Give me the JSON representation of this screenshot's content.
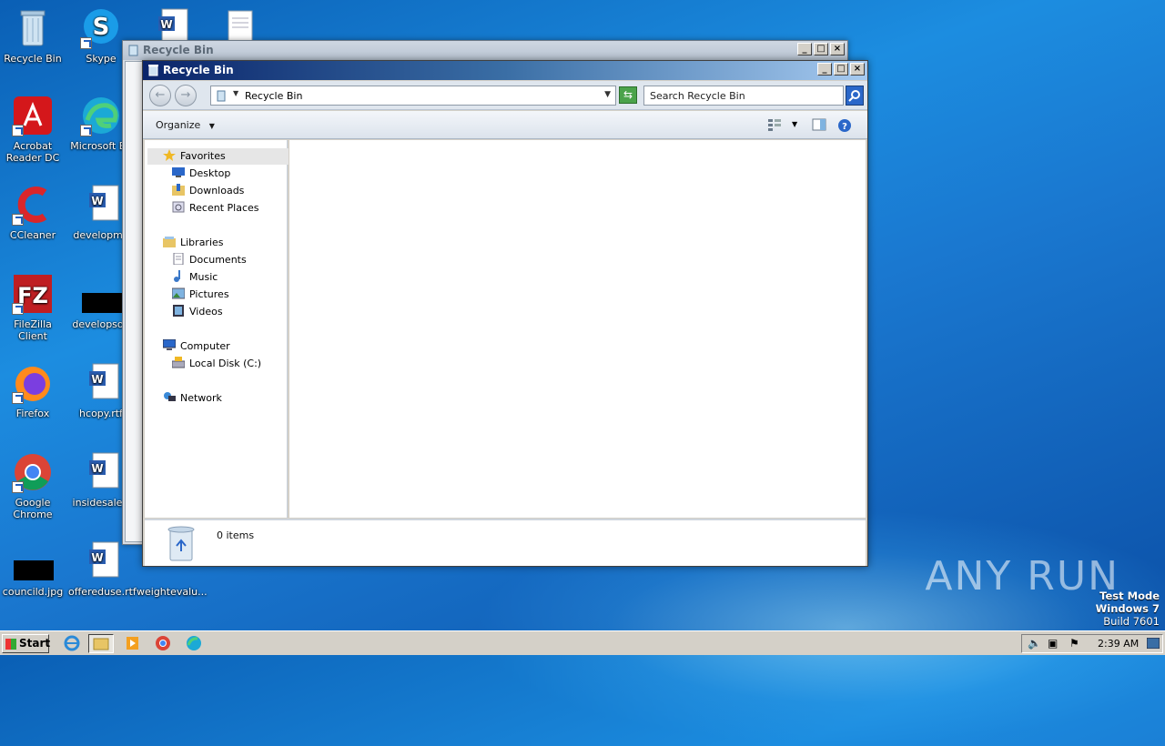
{
  "desktop": {
    "icons": [
      {
        "label": "Recycle Bin"
      },
      {
        "label": "Skype"
      },
      {
        "label": "Acrobat Reader DC"
      },
      {
        "label": "Microsoft Ed"
      },
      {
        "label": "CCleaner"
      },
      {
        "label": "developme"
      },
      {
        "label": "FileZilla Client"
      },
      {
        "label": "developsou"
      },
      {
        "label": "Firefox"
      },
      {
        "label": "hcopy.rtf"
      },
      {
        "label": "Google Chrome"
      },
      {
        "label": "insidesale.r"
      },
      {
        "label": "councild.jpg"
      },
      {
        "label": "offereduse.rtf"
      },
      {
        "label": "weightevalu..."
      }
    ]
  },
  "back_window": {
    "title": "Recycle Bin"
  },
  "window": {
    "title": "Recycle Bin",
    "address": "Recycle Bin",
    "search_placeholder": "Search Recycle Bin",
    "organize_label": "Organize",
    "nav": {
      "favorites": "Favorites",
      "desktop": "Desktop",
      "downloads": "Downloads",
      "recent": "Recent Places",
      "libraries": "Libraries",
      "documents": "Documents",
      "music": "Music",
      "pictures": "Pictures",
      "videos": "Videos",
      "computer": "Computer",
      "local_disk": "Local Disk (C:)",
      "network": "Network"
    },
    "status": "0 items"
  },
  "taskbar": {
    "start_label": "Start",
    "clock": "2:39 AM"
  },
  "watermark": "ANY RUN",
  "os_info": {
    "line1": "Test Mode",
    "line2": "Windows 7",
    "line3": "Build 7601"
  },
  "colors": {
    "titlebar_start": "#0a246a",
    "titlebar_end": "#a6caf0",
    "desktop": "#1a78d0"
  }
}
